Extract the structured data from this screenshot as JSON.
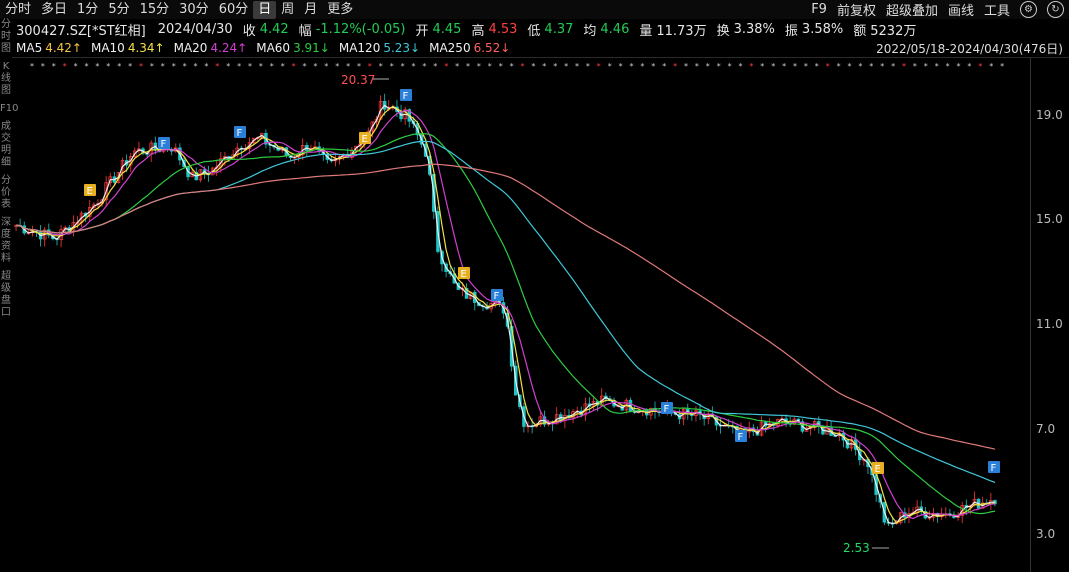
{
  "tabs": [
    "分时",
    "多日",
    "1分",
    "5分",
    "15分",
    "30分",
    "60分",
    "日",
    "周",
    "月",
    "更多"
  ],
  "active_tab": "日",
  "top_right": [
    "F9",
    "前复权",
    "超级叠加",
    "画线",
    "工具"
  ],
  "info": {
    "code": "300427.SZ[*ST红相]",
    "date": "2024/04/30",
    "close_label": "收",
    "close": "4.42",
    "amp_label": "幅",
    "amp": "-1.12%(-0.05)",
    "open_label": "开",
    "open": "4.45",
    "high_label": "高",
    "high": "4.53",
    "low_label": "低",
    "low": "4.37",
    "avg_label": "均",
    "avg": "4.46",
    "vol_label": "量",
    "vol": "11.73万",
    "turn_label": "换",
    "turn": "3.38%",
    "swing_label": "振",
    "swing": "3.58%",
    "amount_label": "额",
    "amount": "5232万"
  },
  "ma": [
    {
      "label": "MA5",
      "value": "4.42↑",
      "color": "#f0f0f0",
      "vcolor": "#f5c542"
    },
    {
      "label": "MA10",
      "value": "4.34↑",
      "color": "#f0f0f0",
      "vcolor": "#f5e142"
    },
    {
      "label": "MA20",
      "value": "4.24↑",
      "color": "#f0f0f0",
      "vcolor": "#d040d0"
    },
    {
      "label": "MA60",
      "value": "3.91↓",
      "color": "#f0f0f0",
      "vcolor": "#2ecc40"
    },
    {
      "label": "MA120",
      "value": "5.23↓",
      "color": "#f0f0f0",
      "vcolor": "#40c8d8"
    },
    {
      "label": "MA250",
      "value": "6.52↓",
      "color": "#f0f0f0",
      "vcolor": "#ff6060"
    }
  ],
  "range": "2022/05/18-2024/04/30(476日)",
  "left_strip": [
    "分时图",
    "K线图",
    "F10",
    "成交明细",
    "分价表",
    "深度资料",
    "超级盘口"
  ],
  "yaxis": {
    "ticks": [
      "19.0",
      "15.0",
      "11.0",
      "7.0",
      "3.0"
    ]
  },
  "annotations": {
    "high": "20.37",
    "low": "2.53"
  },
  "colors": {
    "up": "#ff3b3b",
    "down": "#1fc4c4",
    "ma5": "#f0f0f0",
    "ma10": "#f5e142",
    "ma20": "#d040d0",
    "ma60": "#2ecc40",
    "ma120": "#40c8d8",
    "ma250": "#e07a7a"
  }
}
